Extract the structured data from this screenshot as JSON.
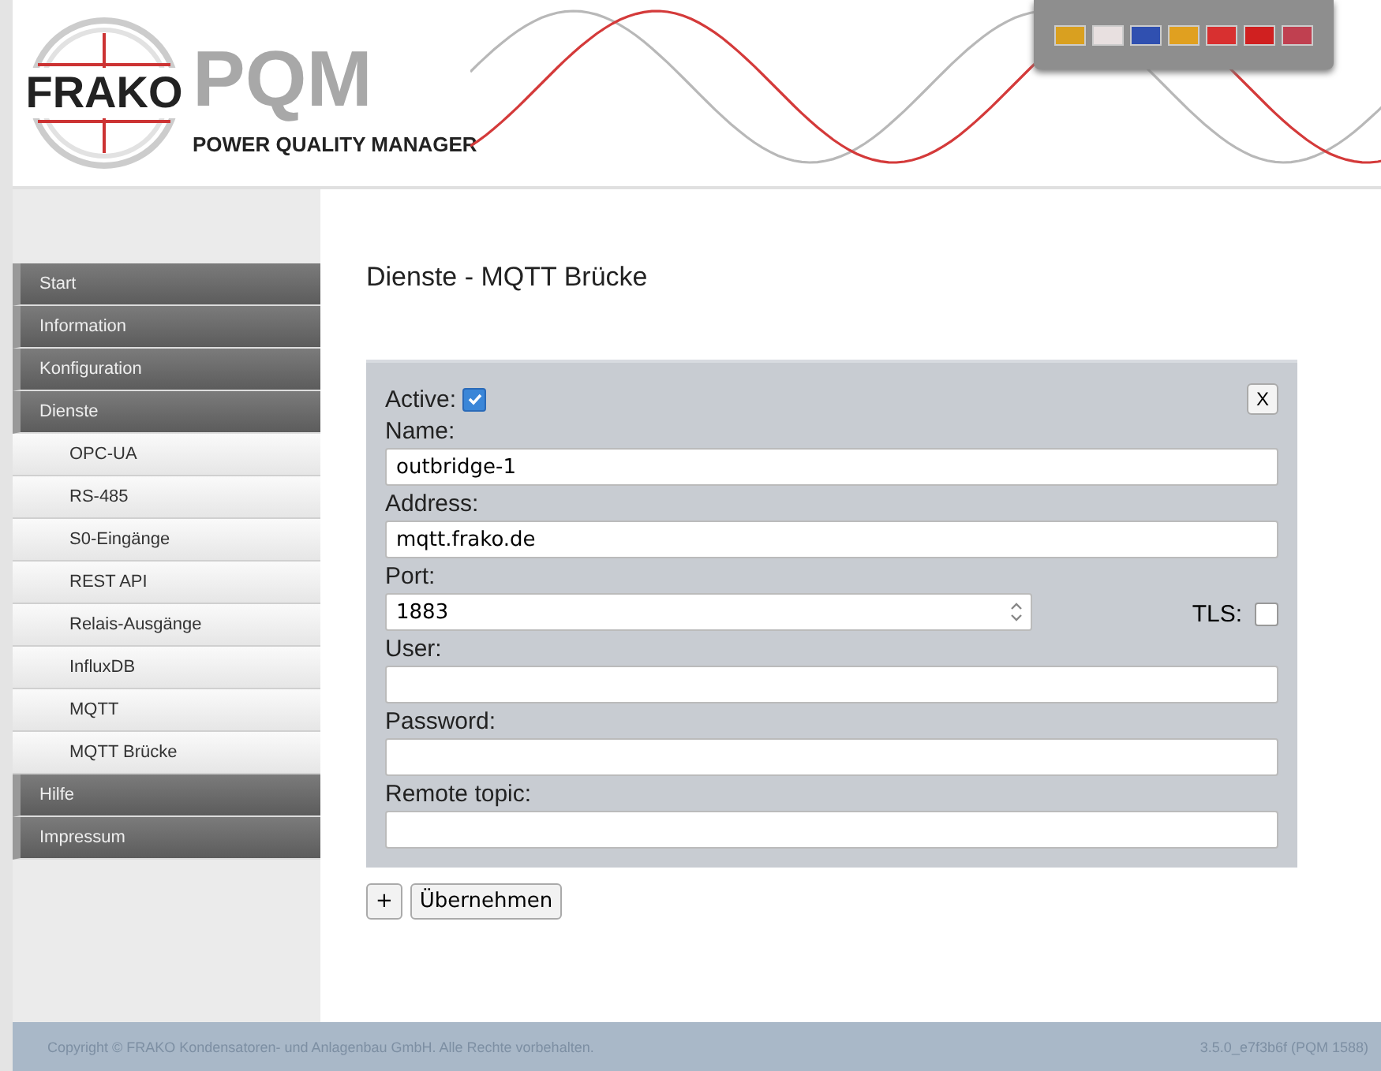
{
  "header": {
    "logo": "FRAKO",
    "product": "PQM",
    "subtitle": "POWER QUALITY MANAGER",
    "languages": [
      {
        "color": "#d9a020"
      },
      {
        "color": "#e8e0e0"
      },
      {
        "color": "#3050b0"
      },
      {
        "color": "#e0a020"
      },
      {
        "color": "#d83030"
      },
      {
        "color": "#d02020"
      },
      {
        "color": "#c04050"
      }
    ]
  },
  "sidebar": {
    "items": [
      {
        "label": "Start"
      },
      {
        "label": "Information"
      },
      {
        "label": "Konfiguration"
      },
      {
        "label": "Dienste",
        "children": [
          {
            "label": "OPC-UA"
          },
          {
            "label": "RS-485"
          },
          {
            "label": "S0-Eingänge"
          },
          {
            "label": "REST API"
          },
          {
            "label": "Relais-Ausgänge"
          },
          {
            "label": "InfluxDB"
          },
          {
            "label": "MQTT"
          },
          {
            "label": "MQTT Brücke"
          }
        ]
      },
      {
        "label": "Hilfe"
      },
      {
        "label": "Impressum"
      }
    ]
  },
  "page_title": "Dienste - MQTT Brücke",
  "bridge": {
    "active_label": "Active:",
    "active": {
      "checked": true
    },
    "close": "X",
    "fields": [
      {
        "label": "Name:",
        "value": "outbridge-1",
        "kind": "text"
      },
      {
        "label": "Address:",
        "value": "mqtt.frako.de",
        "kind": "text"
      },
      {
        "label": "Port:",
        "value": "1883",
        "kind": "number",
        "tls_label": "TLS:",
        "tls": {
          "checked": false
        }
      },
      {
        "label": "User:",
        "kind": "text"
      },
      {
        "label": "Password:",
        "kind": "text"
      },
      {
        "label": "Remote topic:",
        "kind": "text"
      }
    ]
  },
  "buttons": {
    "add": "+",
    "apply": "Übernehmen"
  },
  "footer": {
    "copyright": "Copyright © FRAKO Kondensatoren- und Anlagenbau GmbH. Alle Rechte vorbehalten.",
    "version": "3.5.0_e7f3b6f (PQM 1588)"
  }
}
